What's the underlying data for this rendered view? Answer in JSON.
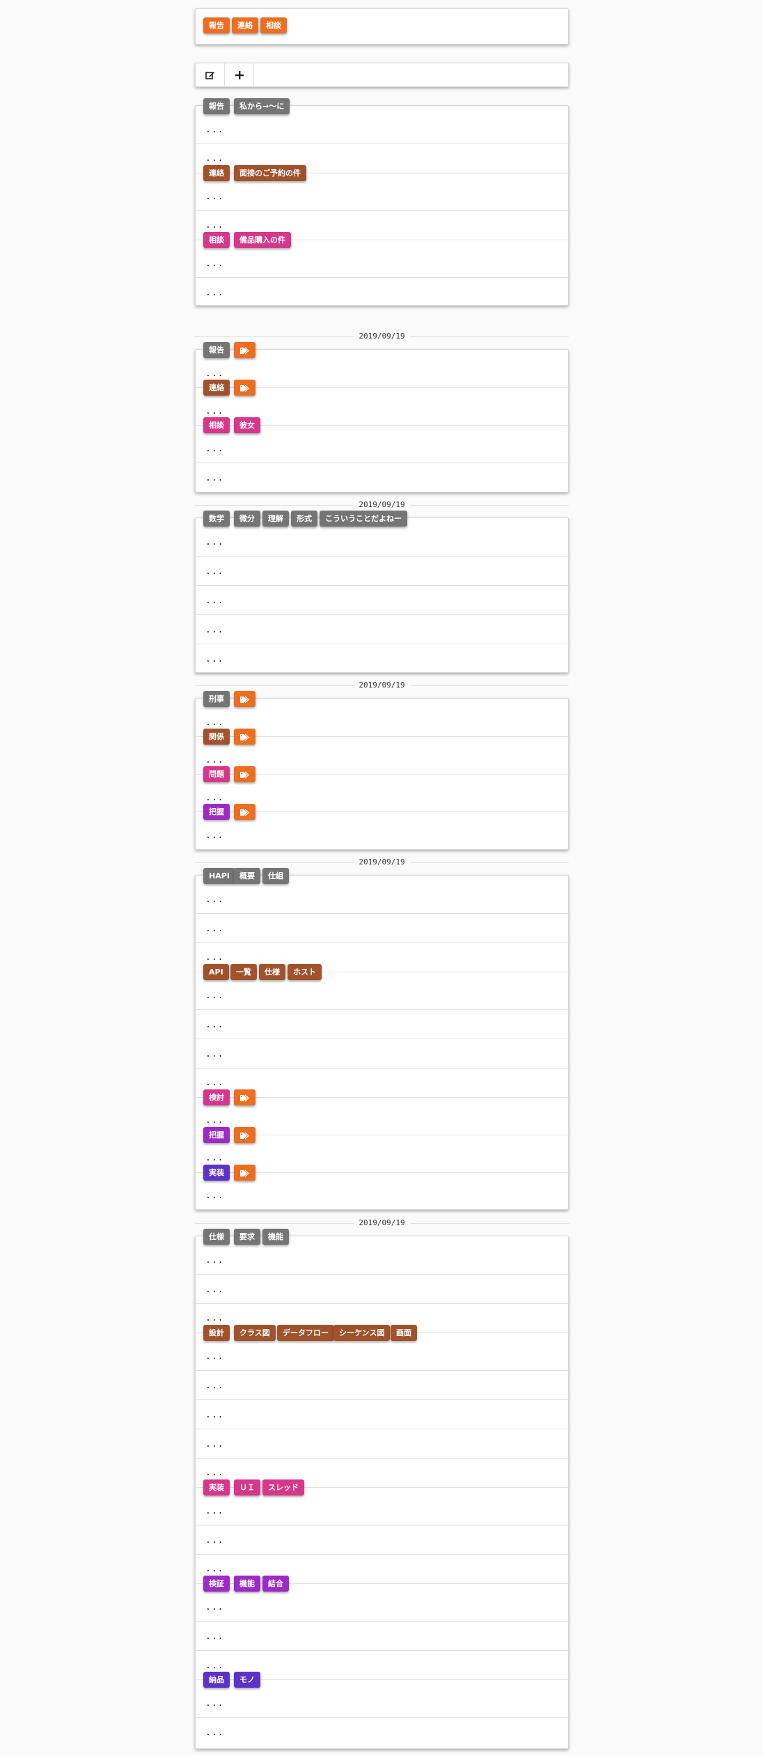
{
  "colors": {
    "gray": "#757575",
    "brown": "#a0522d",
    "pink": "#d6378a",
    "purple": "#9c2bc4",
    "indigo": "#5b33c8",
    "orange": "#ec6e22"
  },
  "top_chips": [
    "報告",
    "連絡",
    "相談"
  ],
  "toolbar": {
    "edit_icon": "edit-icon",
    "add_icon": "plus-icon"
  },
  "ellipsis": "...",
  "card1": {
    "r1": [
      "報告",
      "私から→〜に"
    ],
    "r2": [
      "連絡",
      "面接のご予約の件"
    ],
    "r3": [
      "相談",
      "備品購入の件"
    ]
  },
  "card2": {
    "date": "2019/09/19",
    "r1": "報告",
    "r2": "連絡",
    "r3": [
      "相談",
      "彼女"
    ]
  },
  "card3": {
    "date": "2019/09/19",
    "r1": [
      "数学",
      "微分",
      "理解",
      "形式",
      "こういうことだよねー"
    ]
  },
  "card4": {
    "date": "2019/09/19",
    "r1": "刑事",
    "r2": "関係",
    "r3": "問題",
    "r4": "把握"
  },
  "card5": {
    "date": "2019/09/19",
    "r1": [
      "HAPI",
      "概要",
      "仕組"
    ],
    "r2": [
      "API",
      "一覧",
      "仕様",
      "ホスト"
    ],
    "r3": "検討",
    "r4": "把握",
    "r5": "実装"
  },
  "card6": {
    "date": "2019/09/19",
    "r1": [
      "仕様",
      "要求",
      "機能"
    ],
    "r2": [
      "設計",
      "クラス図",
      "データフロー",
      "シーケンス図",
      "画面"
    ],
    "r3": [
      "実装",
      "ＵＩ",
      "スレッド"
    ],
    "r4": [
      "検証",
      "機能",
      "結合"
    ],
    "r5": [
      "納品",
      "モノ"
    ]
  }
}
